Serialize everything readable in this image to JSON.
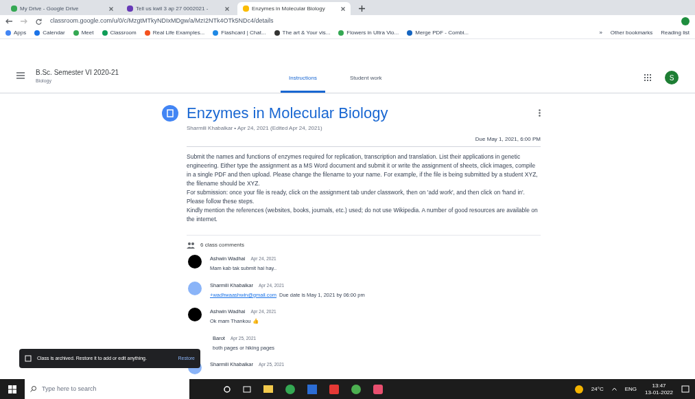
{
  "browser": {
    "tabs": [
      {
        "title": "My Drive - Google Drive",
        "selected": false
      },
      {
        "title": "Tell us kwil 3 ap 27 0002021 -",
        "selected": false
      },
      {
        "title": "Enzymes in Molecular Biology",
        "selected": true
      }
    ],
    "url": "classroom.google.com/u/0/c/MzgtMTkyNDIxMDgw/a/MzI2NTk4OTk5NDc4/details",
    "bookmarks": [
      "Apps",
      "Calendar",
      "Meet",
      "Classroom",
      "Real Life Examples...",
      "Flashcard | Chat...",
      "The art & Your vis...",
      "Flowers in Ultra Vio...",
      "Merge PDF - Combi..."
    ],
    "bookmarks_more": "»",
    "other_bookmarks": "Other bookmarks",
    "reading_list": "Reading list"
  },
  "header": {
    "class_name": "B.Sc. Semester VI 2020-21",
    "subtitle": "Biology",
    "tabs": [
      {
        "label": "Instructions",
        "selected": true
      },
      {
        "label": "Student work",
        "selected": false
      }
    ],
    "avatar": "S"
  },
  "assignment": {
    "title": "Enzymes in Molecular Biology",
    "meta": "Sharmili Khabalkar • Apr 24, 2021 (Edited Apr 24, 2021)",
    "due": "Due May 1, 2021, 6:00 PM",
    "paragraphs": [
      "Submit the names and functions of enzymes required for replication, transcription and translation. List their applications in genetic engineering. Either type the assignment as a MS Word document and submit it or write the assignment of sheets, click images, compile in a single PDF and then upload. Please change the filename to your name. For example, if the file is being submitted by a student XYZ, the filename should be XYZ.",
      "For submission: once your file is ready, click on the assignment tab under classwork, then on 'add work', and then click on 'hand in'. Please follow these steps.",
      "Kindly mention the references (websites, books, journals, etc.) used; do not use Wikipedia. A number of good resources are available on the internet."
    ]
  },
  "comments": {
    "heading": "6 class comments",
    "items": [
      {
        "kind": "dark",
        "author": "Ashwin Wadhai",
        "date": "Apr 24, 2021",
        "text": "Mam kab tak submit hai hay.."
      },
      {
        "kind": "person",
        "author": "Sharmili Khabalkar",
        "date": "Apr 24, 2021",
        "mention": "+wadhwaashwin@gmail.com",
        "text": "Due date is May 1, 2021 by 06:00 pm"
      },
      {
        "kind": "dark",
        "author": "Ashwin Wadhai",
        "date": "Apr 24, 2021",
        "text": "Ok mam Thankou 👍"
      },
      {
        "kind": "covered",
        "author": "Barot",
        "date": "Apr 25, 2021",
        "text": "both pages or hiking pages"
      },
      {
        "kind": "person",
        "author": "Sharmili Khabalkar",
        "date": "Apr 25, 2021"
      }
    ]
  },
  "snackbar": {
    "message": "Class is archived. Restore it to add or edit anything.",
    "action": "Restore"
  },
  "taskbar": {
    "search_placeholder": "Type here to search",
    "weather": "24°C",
    "language": "ENG",
    "time": "13:47",
    "date": "13-01-2022"
  }
}
